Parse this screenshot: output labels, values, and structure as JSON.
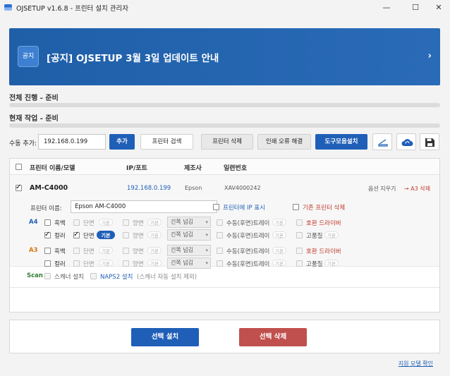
{
  "window": {
    "title": "OJSETUP v1.6.8 - 프린터 설치 관리자",
    "minimize": "—",
    "maximize": "☐",
    "close": "✕"
  },
  "banner": {
    "badge": "공지",
    "title": "[공지] OJSETUP 3월 3일 업데이트 안내",
    "arrow": "›"
  },
  "progress": {
    "overall_label": "전체 진행 - 준비",
    "overall_value": 0,
    "current_label": "현재 작업 - 준비",
    "current_value": 0
  },
  "toolbar": {
    "add_label": "수동 추가:",
    "ip_value": "192.168.0.199",
    "add_button": "추가",
    "search_button": "프린터 검색",
    "delete_button": "프린터 삭제",
    "error_button": "인쇄 오류 해결",
    "tools_button": "도구모음설치",
    "icons": [
      "scanner-icon",
      "cloud-sync-icon",
      "save-icon"
    ]
  },
  "table": {
    "headers": {
      "name": "프린터 이름/모델",
      "ip": "IP/포트",
      "maker": "제조사",
      "serial": "일련번호"
    },
    "row": {
      "model": "AM-C4000",
      "ip": "192.168.0.199",
      "maker": "Epson",
      "serial": "XAV4000242",
      "clear_options": "옵션 지우기",
      "delete_a3": "→ A3 삭제"
    },
    "detail": {
      "printer_name_label": "프린터 이름:",
      "printer_name_value": "Epson AM-C4000",
      "show_ip": "프린터에 IP 표시",
      "delete_existing": "기존 프린터 삭제",
      "a4": "A4",
      "a3": "A3",
      "mono": "흑백",
      "color": "컬러",
      "simplex": "단면",
      "duplex": "양면",
      "tag_default": "기본",
      "flip": "긴쪽 넘김",
      "tray": "수동(후면)트레이",
      "compat_driver": "호환 드라이버",
      "high_quality": "고품질",
      "scan_label": "Scan",
      "scanner_install": "스캐너 설치",
      "naps2_install": "NAPS2 설치",
      "naps2_note": "(스캐너 자동 설치 제외)"
    }
  },
  "actions": {
    "install_button": "선택 설치",
    "delete_button": "선택 삭제",
    "support_link": "지원 모델 확인"
  },
  "colors": {
    "accent": "#1f5fb8",
    "danger": "#c0504d",
    "banner": "#1f5fa8"
  }
}
